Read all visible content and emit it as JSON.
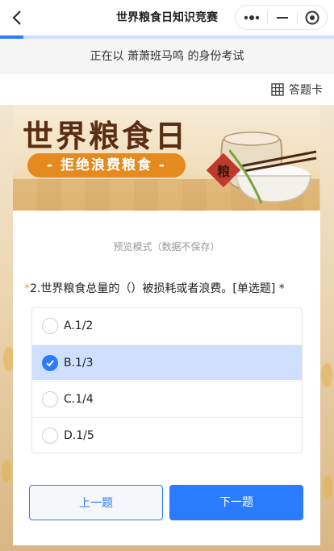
{
  "nav": {
    "title": "世界粮食日知识竞赛"
  },
  "progress": {
    "fraction": 0.07
  },
  "identity": {
    "text": "正在以 萧萧班马鸣 的身份考试"
  },
  "answer_card": {
    "label": "答题卡"
  },
  "banner": {
    "title": "世界粮食日",
    "slogan": "- 拒绝浪费粮食 -",
    "sack_text": "粮"
  },
  "preview": {
    "text": "预览模式（数据不保存）"
  },
  "question": {
    "required_mark": "*",
    "text": "2.世界粮食总量的（）被损耗或者浪费。[单选题] *"
  },
  "options": [
    {
      "label": "A.1/2",
      "selected": false
    },
    {
      "label": "B.1/3",
      "selected": true
    },
    {
      "label": "C.1/4",
      "selected": false
    },
    {
      "label": "D.1/5",
      "selected": false
    }
  ],
  "buttons": {
    "prev": "上一题",
    "next": "下一题"
  },
  "colors": {
    "accent": "#2b7bff",
    "selected_bg": "#cfe0ff",
    "banner_orange": "#e48a1f"
  }
}
